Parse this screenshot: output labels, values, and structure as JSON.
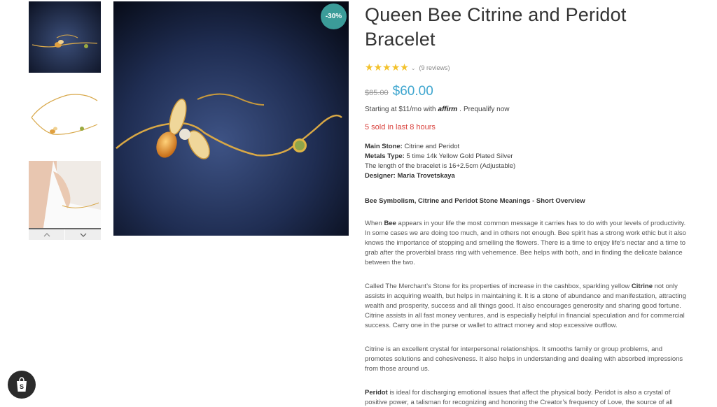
{
  "product": {
    "title": "Queen Bee Citrine and Peridot Bracelet",
    "badge": "-30%",
    "rating_stars": 5,
    "reviews": "(9 reviews)",
    "old_price": "$85.00",
    "new_price": "$60.00",
    "affirm_prefix": "Starting at $11/mo with",
    "affirm_logo": "affirm",
    "affirm_suffix": ".",
    "affirm_link": "Prequalify now",
    "sold": "5 sold in last 8 hours"
  },
  "specs": {
    "main_stone_label": "Main Stone:",
    "main_stone": " Citrine and Peridot",
    "metals_label": "Metals Type:",
    "metals": " 5 time 14k Yellow Gold Plated Silver",
    "length": "The length of the bracelet is 16+2.5cm (Adjustable)",
    "designer": "Designer: Maria Trovetskaya"
  },
  "description": {
    "heading": "Bee Symbolism, Citrine and Peridot Stone Meanings - Short Overview",
    "p1_a": "When ",
    "p1_b": "Bee",
    "p1_c": " appears in your life the most common message it carries has to do with your levels of productivity. In some cases we are doing too much, and in others not enough. Bee spirit has a strong work ethic but it also knows the importance of stopping and smelling the flowers. There is a time to enjoy life’s nectar and a time to grab after the proverbial brass ring with vehemence. Bee helps with both, and in finding the delicate balance between the two.",
    "p2_a": "Called The Merchant’s Stone for its properties of increase in the cashbox, sparkling yellow ",
    "p2_b": "Citrine",
    "p2_c": " not only assists in acquiring wealth, but helps in maintaining it. It is a stone of abundance and manifestation, attracting wealth and prosperity, success and all things good. It also encourages generosity and sharing good fortune. Citrine assists in all fast money ventures, and is especially helpful in financial speculation and for commercial success. Carry one in the purse or wallet to attract money and stop excessive outflow.",
    "p3": "Citrine is an excellent crystal for interpersonal relationships. It smooths family or group problems, and promotes solutions and cohesiveness. It also helps in understanding and dealing with absorbed impressions from those around us.",
    "p4_a": "Peridot",
    "p4_b": " is ideal for discharging emotional issues that affect the physical body. Peridot is also a crystal of positive power, a talisman for recognizing and honoring the Creator’s frequency of Love, the source of all"
  },
  "colors": {
    "badge": "#3b9c99",
    "price": "#3fa6cf",
    "sold": "#d9413c",
    "stars": "#f3c22c"
  },
  "icons": [
    "chevron-up-icon",
    "chevron-down-icon",
    "star-icon",
    "shopify-bag-icon"
  ]
}
